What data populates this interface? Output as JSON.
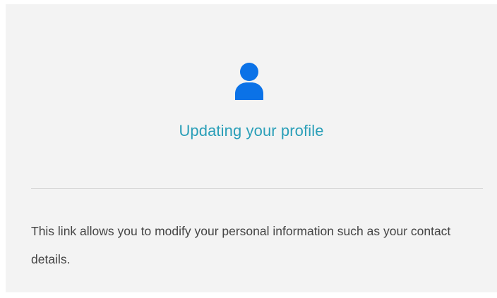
{
  "card": {
    "icon": "user-profile-icon",
    "title": "Updating your profile",
    "description": "This link allows you to modify your personal information such as your contact details."
  },
  "colors": {
    "card_background": "#f3f3f3",
    "icon": "#0b72e7",
    "title": "#2a9fb8",
    "text": "#444444",
    "divider": "#d8d8d8"
  }
}
